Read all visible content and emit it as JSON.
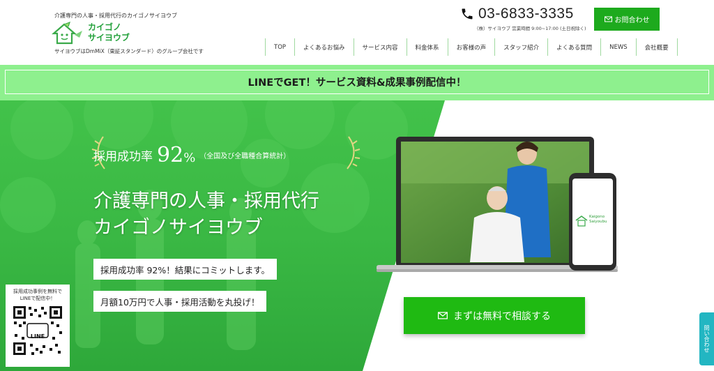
{
  "header": {
    "tagline": "介護専門の人事・採用代行のカイゴノサイヨウブ",
    "logo_line1": "カイゴノ",
    "logo_line2": "サイヨウブ",
    "subtag": "サイヨウブはDmMiX（東証スタンダード）のグループ会社です",
    "phone": "03-6833-3335",
    "hours": "（株）サイヨウブ 営業時間 9:00~17:00 (土日祝除く)",
    "contact_label": "お問合わせ"
  },
  "nav": {
    "items": [
      "TOP",
      "よくあるお悩み",
      "サービス内容",
      "料金体系",
      "お客様の声",
      "スタッフ紹介",
      "よくある質問",
      "NEWS",
      "会社概要"
    ]
  },
  "banner": {
    "text": "LINEでGET！サービス資料&成果事例配信中！"
  },
  "hero": {
    "rate_label": "採用成功率",
    "rate_value": "92",
    "rate_unit": "%",
    "rate_note": "（全国及び全職種合算統計）",
    "title_line1": "介護専門の人事・採用代行",
    "title_line2": "カイゴノサイヨウブ",
    "pill1": "採用成功率 92%！結果にコミットします。",
    "pill2": "月額10万円で人事・採用活動を丸投げ！",
    "qr_caption_line1": "採用成功事例を無料で",
    "qr_caption_line2": "LINEで配信中！",
    "qr_text": "LINE",
    "cta_label": "まずは無料で相談する",
    "phone_logo_line1": "Kaigono",
    "phone_logo_line2": "Saiyoubu"
  },
  "side_tab": {
    "label": "問い合わせ"
  },
  "colors": {
    "brand_green": "#1daa1d",
    "banner_green": "#8ef08e",
    "side_tab": "#22b6c2"
  }
}
